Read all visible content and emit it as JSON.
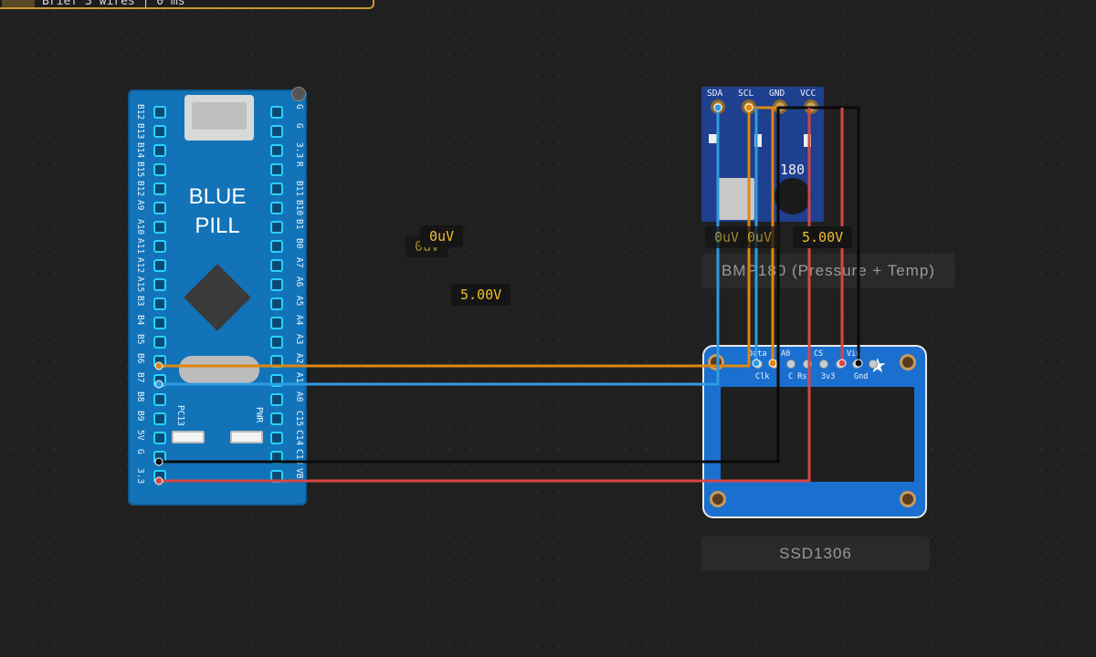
{
  "top_status": {
    "text": "Brief 3 wires  |  0 ms"
  },
  "probes": {
    "p1": "0uV",
    "p2": "0uV",
    "p3": "5.00V",
    "p4": "0uV",
    "p5": "0uV",
    "p6": "5.00V"
  },
  "blue_pill": {
    "title_line1": "BLUE",
    "title_line2": "PILL",
    "left_pins": [
      "B12",
      "B13",
      "B14",
      "B15",
      "B12",
      "A9",
      "A10",
      "A11",
      "A12",
      "A15",
      "B3",
      "B4",
      "B5",
      "B6",
      "B7",
      "B8",
      "B9",
      "5V",
      "G",
      "3.3"
    ],
    "right_pins": [
      "G",
      "G",
      "3.3",
      "R",
      "B11",
      "B10",
      "B1",
      "B0",
      "A7",
      "A6",
      "A5",
      "A4",
      "A3",
      "A2",
      "A1",
      "A0",
      "C15",
      "C14",
      "C13",
      "VB"
    ],
    "led_labels": {
      "pc13": "PC13",
      "pwr": "PWR"
    }
  },
  "bmp180": {
    "pins": [
      "SDA",
      "SCL",
      "GND",
      "VCC"
    ],
    "chip_text": "180",
    "label": "BMP180 (Pressure + Temp)"
  },
  "ssd1306": {
    "top_pins": [
      "Data",
      "A0",
      "CS",
      "Vin"
    ],
    "bottom_pins": [
      "Clk",
      "C Rst",
      "3v3",
      "Gnd"
    ],
    "label": "SSD1306"
  },
  "colors": {
    "scl_wire": "#e0860f",
    "sda_wire": "#2f9be0",
    "gnd_wire": "#0a0a0a",
    "vcc_wire": "#d64545",
    "board_blue": "#1273b8",
    "oled_blue": "#1a6fcf",
    "accent": "#f2c12e"
  }
}
